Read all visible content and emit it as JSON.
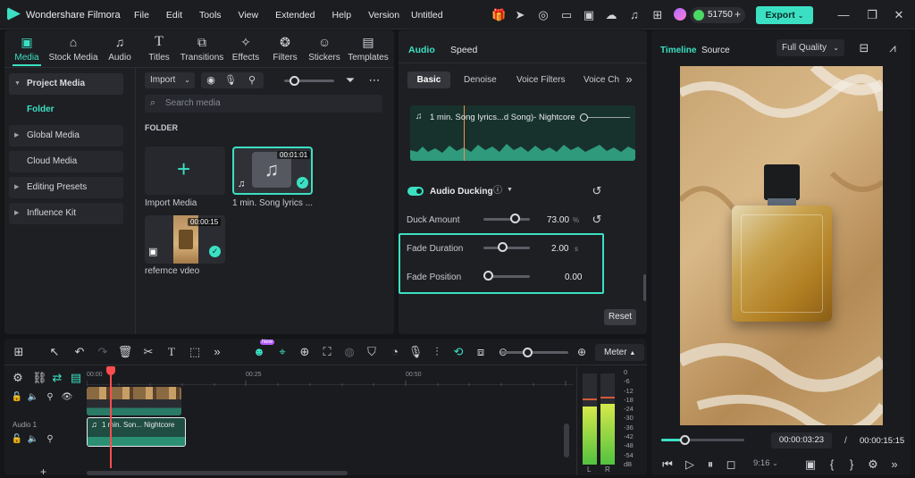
{
  "app": {
    "name": "Wondershare Filmora",
    "project_title": "Untitled",
    "credits": "51750",
    "export_label": "Export"
  },
  "menu": [
    "File",
    "Edit",
    "Tools",
    "View",
    "Extended",
    "Help",
    "Version"
  ],
  "media_tabs": [
    {
      "label": "Media",
      "icon": "media-icon"
    },
    {
      "label": "Stock Media",
      "icon": "stock-media-icon"
    },
    {
      "label": "Audio",
      "icon": "audio-icon"
    },
    {
      "label": "Titles",
      "icon": "titles-icon"
    },
    {
      "label": "Transitions",
      "icon": "transitions-icon"
    },
    {
      "label": "Effects",
      "icon": "effects-icon"
    },
    {
      "label": "Filters",
      "icon": "filters-icon"
    },
    {
      "label": "Stickers",
      "icon": "stickers-icon"
    },
    {
      "label": "Templates",
      "icon": "templates-icon"
    }
  ],
  "sidebar": {
    "items": [
      "Project Media",
      "Folder",
      "Global Media",
      "Cloud Media",
      "Editing Presets",
      "Influence Kit"
    ]
  },
  "media_browser": {
    "import_label": "Import",
    "search_placeholder": "Search media",
    "folder_label": "FOLDER",
    "import_media_label": "Import Media",
    "song_duration": "00:01:01",
    "song_name": "1 min. Song lyrics ...",
    "video_duration": "00:00:15",
    "video_name": "refernce vdeo"
  },
  "audio_panel": {
    "tabs": [
      "Audio",
      "Speed"
    ],
    "subtabs": [
      "Basic",
      "Denoise",
      "Voice Filters",
      "Voice Ch"
    ],
    "clip_name": "1 min. Song lyrics...d Song)- Nightcore",
    "ducking_label": "Audio Ducking",
    "duck_amount_label": "Duck Amount",
    "duck_amount_value": "73.00",
    "duck_amount_unit": "%",
    "duck_amount_fraction": 0.73,
    "fade_duration_label": "Fade Duration",
    "fade_duration_value": "2.00",
    "fade_duration_unit": "s",
    "fade_duration_fraction": 0.4,
    "fade_position_label": "Fade Position",
    "fade_position_value": "0.00",
    "fade_position_fraction": 0.0,
    "reset_label": "Reset"
  },
  "preview": {
    "tabs": [
      "Timeline",
      "Source"
    ],
    "quality": "Full Quality",
    "current_time": "00:00:03:23",
    "separator": "/",
    "total_time": "00:00:15:15",
    "aspect": "9:16",
    "progress_fraction": 0.25
  },
  "timeline": {
    "meter_label": "Meter",
    "new_badge": "New",
    "ruler": [
      "00:00",
      "00:25",
      "00:50"
    ],
    "audio_track_label": "Audio 1",
    "audio_clip_name": "1 min. Son... Nightcore",
    "meter_scale": [
      "0",
      "-6",
      "-12",
      "-18",
      "-24",
      "-30",
      "-36",
      "-42",
      "-48",
      "-54",
      "dB"
    ],
    "meter_channels": [
      "L",
      "R"
    ]
  },
  "colors": {
    "accent": "#3be0c3",
    "panel": "#1e1f23",
    "bg": "#141517",
    "playhead": "#ff4d4f"
  }
}
